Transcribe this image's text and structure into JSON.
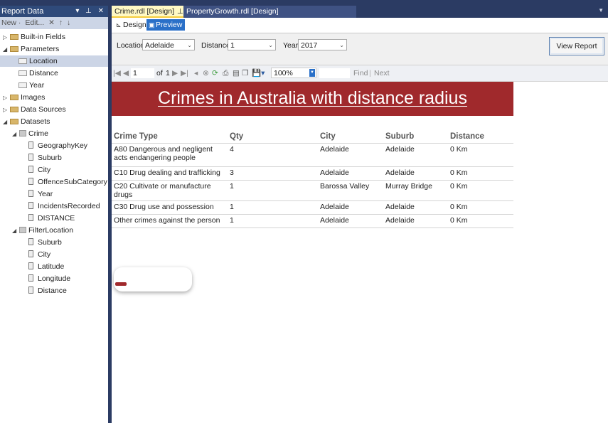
{
  "panel": {
    "title": "Report Data",
    "title_buttons": "▾ ⊥ ✕",
    "toolbar": {
      "new": "New ·",
      "edit": "Edit...",
      "delete": "✕",
      "up": "↑",
      "down": "↓"
    },
    "tree": {
      "built_in_fields": "Built-in Fields",
      "parameters": "Parameters",
      "param_location": "Location",
      "param_distance": "Distance",
      "param_year": "Year",
      "images": "Images",
      "data_sources": "Data Sources",
      "datasets": "Datasets",
      "crime": "Crime",
      "crime_fields": [
        "GeographyKey",
        "Suburb",
        "City",
        "OffenceSubCategory",
        "Year",
        "IncidentsRecorded",
        "DISTANCE"
      ],
      "filter_location": "FilterLocation",
      "filter_fields": [
        "Suburb",
        "City",
        "Latitude",
        "Longitude",
        "Distance"
      ]
    }
  },
  "tabs": {
    "crime": "Crime.rdl [Design]",
    "property": "PropertyGrowth.rdl [Design]"
  },
  "view": {
    "design": "Design",
    "preview": "Preview"
  },
  "params": {
    "location_label": "Location",
    "location_value": "Adelaide",
    "distance_label": "Distance",
    "distance_value": "1",
    "year_label": "Year",
    "year_value": "2017",
    "view_report": "View Report"
  },
  "toolbar": {
    "page": "1",
    "of": "of",
    "total_pages": "1",
    "zoom": "100%",
    "find": "Find",
    "separator": "|",
    "next": "Next"
  },
  "report": {
    "title": "Crimes in Australia with distance radius",
    "headers": [
      "Crime Type",
      "Qty",
      "City",
      "Suburb",
      "Distance"
    ],
    "rows": [
      [
        "A80 Dangerous and negligent acts endangering people",
        "4",
        "Adelaide",
        "Adelaide",
        "0 Km"
      ],
      [
        "C10 Drug dealing and trafficking",
        "3",
        "Adelaide",
        "Adelaide",
        "0 Km"
      ],
      [
        "C20 Cultivate or manufacture drugs",
        "1",
        "Barossa Valley",
        "Murray Bridge",
        "0 Km"
      ],
      [
        "C30 Drug use and possession",
        "1",
        "Adelaide",
        "Adelaide",
        "0 Km"
      ],
      [
        "Other crimes against the person",
        "1",
        "Adelaide",
        "Adelaide",
        "0 Km"
      ]
    ]
  },
  "colors": {
    "chrome": "#2b3b63",
    "title_band": "#a0292c",
    "preview": "#2a70c8",
    "active_tab": "#fff9c4"
  }
}
